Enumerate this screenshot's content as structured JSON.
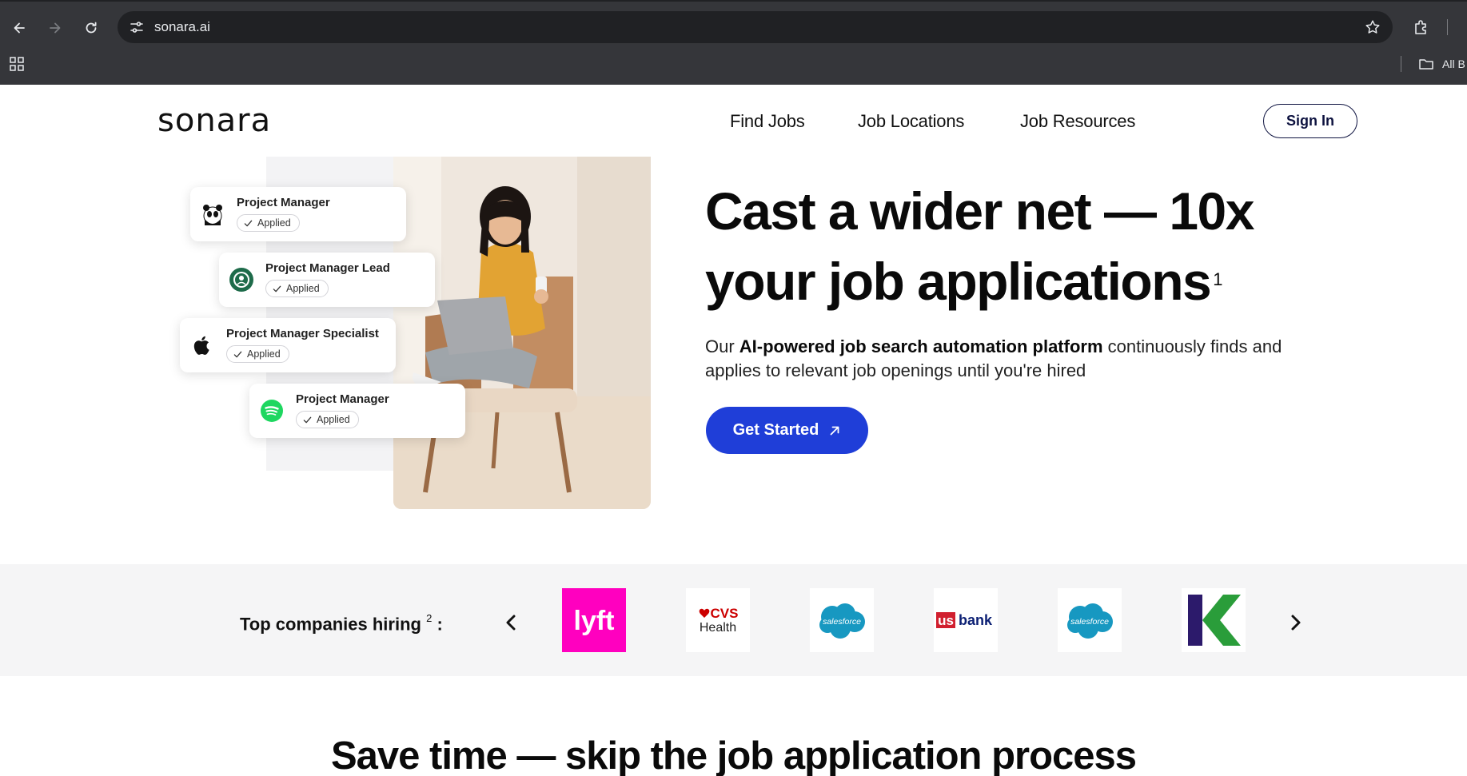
{
  "browser": {
    "url": "sonara.ai",
    "bookmarks_label": "All B"
  },
  "header": {
    "logo": "sonara",
    "nav": [
      "Find Jobs",
      "Job Locations",
      "Job Resources"
    ],
    "signin_label": "Sign In"
  },
  "hero": {
    "title_line1": "Cast a wider net — 10x",
    "title_line2": "your job applications",
    "title_footnote": "1",
    "subtitle_prefix": "Our ",
    "subtitle_bold": "AI-powered job search automation platform",
    "subtitle_suffix": " continuously finds and applies to relevant job openings until you're hired",
    "cta_label": "Get Started",
    "job_cards": [
      {
        "company_icon": "wwf-panda-icon",
        "title": "Project Manager",
        "status": "Applied"
      },
      {
        "company_icon": "starbucks-icon",
        "title": "Project Manager Lead",
        "status": "Applied"
      },
      {
        "company_icon": "apple-icon",
        "title": "Project Manager Specialist",
        "status": "Applied"
      },
      {
        "company_icon": "spotify-icon",
        "title": "Project Manager",
        "status": "Applied"
      }
    ]
  },
  "companies": {
    "label": "Top companies hiring",
    "footnote": "2",
    "colon": ":",
    "logos": [
      {
        "name": "lyft",
        "text": "lyft",
        "color": "#ff00bf"
      },
      {
        "name": "cvs-health",
        "text_top": "CVS",
        "text_bottom": "Health",
        "color": "#cc0000"
      },
      {
        "name": "salesforce",
        "text": "salesforce",
        "color": "#1798c1"
      },
      {
        "name": "usbank",
        "text_prefix": "us",
        "text_suffix": "bank",
        "color": "#0c2074"
      },
      {
        "name": "salesforce",
        "text": "salesforce",
        "color": "#1798c1"
      },
      {
        "name": "k-logo",
        "color": "#2a9d3a"
      }
    ]
  },
  "section": {
    "title": "Save time — skip the job application process"
  },
  "colors": {
    "primary_blue": "#1f3ed8",
    "navy": "#0e1340",
    "chrome_bg": "#35363a"
  }
}
